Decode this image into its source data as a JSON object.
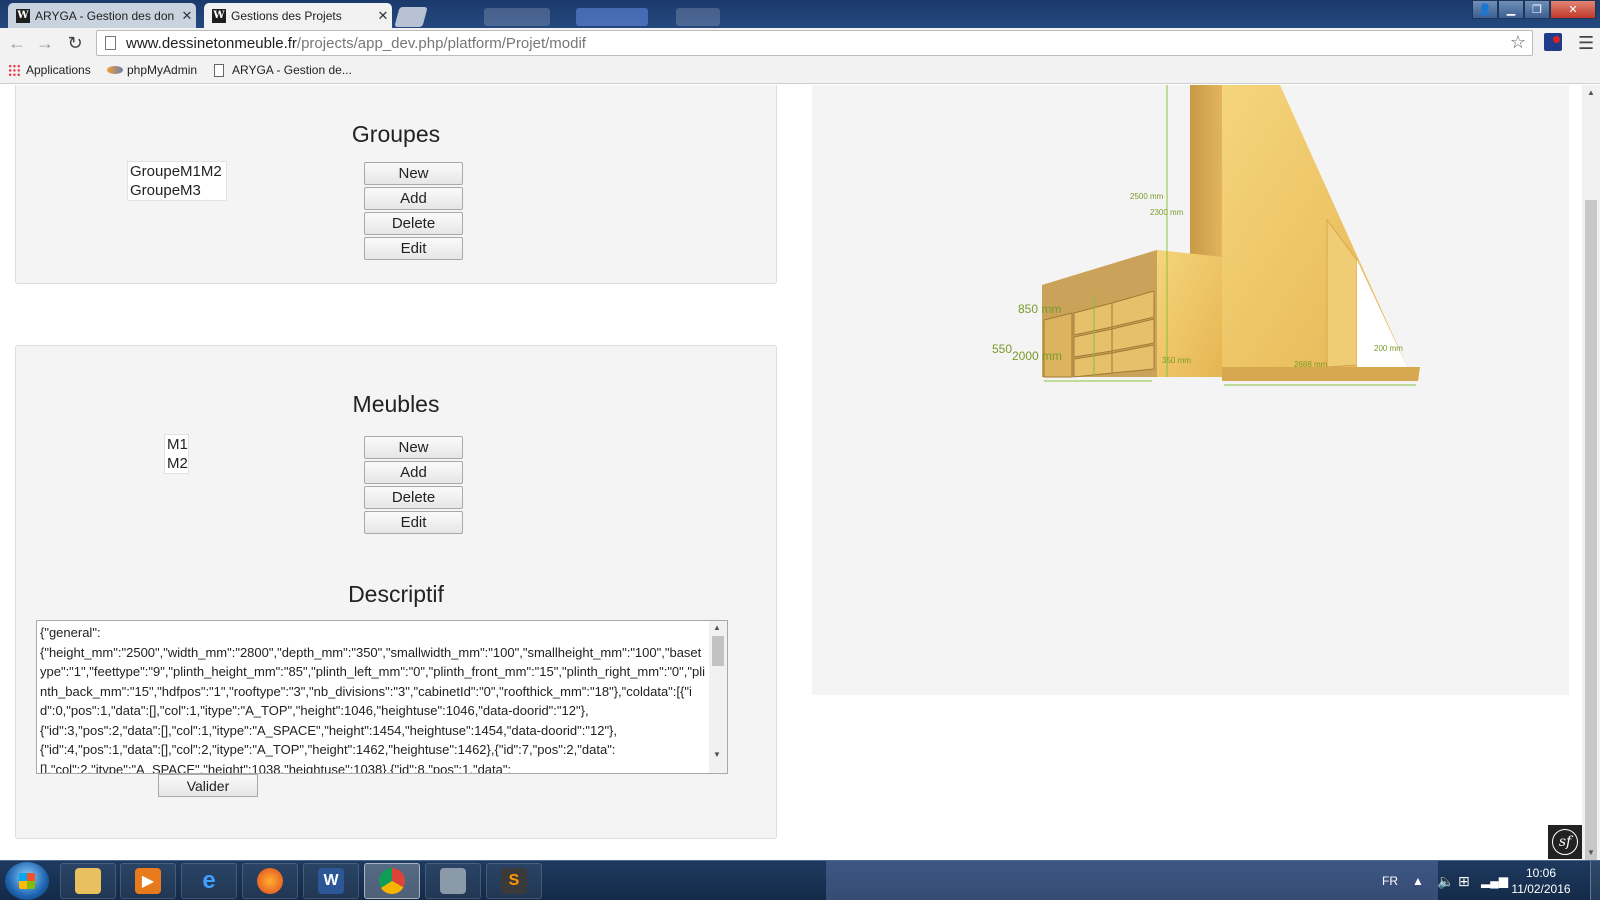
{
  "browser": {
    "tabs": [
      {
        "title": "ARYGA - Gestion des don",
        "favicon": "W",
        "active": false
      },
      {
        "title": "Gestions des Projets",
        "favicon": "W",
        "active": true
      }
    ],
    "url_host": "www.dessinetonmeuble.fr",
    "url_path": "/projects/app_dev.php/platform/Projet/modif",
    "bookmarks": [
      "Applications",
      "phpMyAdmin",
      "ARYGA - Gestion de..."
    ]
  },
  "groupes": {
    "title": "Groupes",
    "items": [
      "GroupeM1M2",
      "GroupeM3"
    ],
    "buttons": {
      "new": "New",
      "add": "Add",
      "delete": "Delete",
      "edit": "Edit"
    }
  },
  "meubles": {
    "title": "Meubles",
    "items": [
      "M1",
      "M2"
    ],
    "buttons": {
      "new": "New",
      "add": "Add",
      "delete": "Delete",
      "edit": "Edit"
    }
  },
  "descriptif": {
    "title": "Descriptif",
    "text": "{\"general\":\n{\"height_mm\":\"2500\",\"width_mm\":\"2800\",\"depth_mm\":\"350\",\"smallwidth_mm\":\"100\",\"smallheight_mm\":\"100\",\"basetype\":\"1\",\"feettype\":\"9\",\"plinth_height_mm\":\"85\",\"plinth_left_mm\":\"0\",\"plinth_front_mm\":\"15\",\"plinth_right_mm\":\"0\",\"plinth_back_mm\":\"15\",\"hdfpos\":\"1\",\"rooftype\":\"3\",\"nb_divisions\":\"3\",\"cabinetId\":\"0\",\"roofthick_mm\":\"18\"},\"coldata\":[{\"id\":0,\"pos\":1,\"data\":[],\"col\":1,\"itype\":\"A_TOP\",\"height\":1046,\"heightuse\":1046,\"data-doorid\":\"12\"},\n{\"id\":3,\"pos\":2,\"data\":[],\"col\":1,\"itype\":\"A_SPACE\",\"height\":1454,\"heightuse\":1454,\"data-doorid\":\"12\"},\n{\"id\":4,\"pos\":1,\"data\":[],\"col\":2,\"itype\":\"A_TOP\",\"height\":1462,\"heightuse\":1462},{\"id\":7,\"pos\":2,\"data\":\n[],\"col\":2,\"itype\":\"A_SPACE\",\"height\":1038,\"heightuse\":1038},{\"id\":8,\"pos\":1,\"data\":",
    "submit": "Valider"
  },
  "viewer_labels": {
    "h2500": "2500 mm",
    "h2300": "2300 mm",
    "h850": "850 mm",
    "h550": "550",
    "h2000": "2000 mm",
    "d350": "350 mm",
    "w2688": "2688 mm",
    "w200": "200 mm"
  },
  "tray": {
    "lang": "FR",
    "time": "10:06",
    "date": "11/02/2016"
  }
}
